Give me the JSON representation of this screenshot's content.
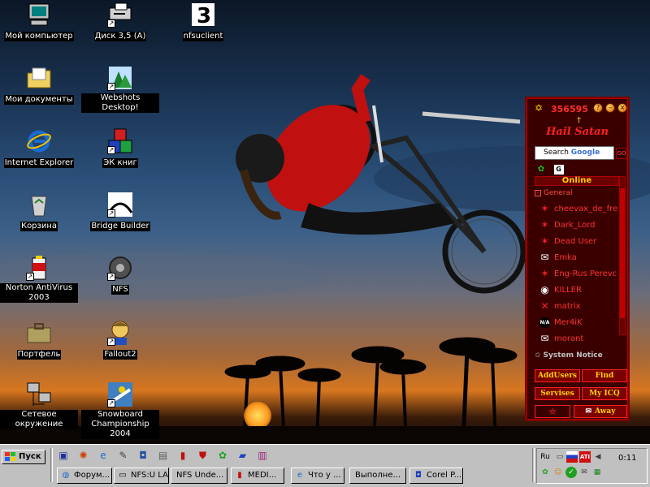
{
  "desktop": {
    "icons": [
      {
        "label": "Мой компьютер",
        "icon": "my-computer-icon"
      },
      {
        "label": "Диск 3,5 (А)",
        "icon": "floppy-drive-icon"
      },
      {
        "label": "nfsuclient",
        "icon": "nfsuclient-icon"
      },
      {
        "label": "Мои документы",
        "icon": "my-documents-icon"
      },
      {
        "label": "Webshots Desktop!",
        "icon": "webshots-icon"
      },
      {
        "label": "Internet Explorer",
        "icon": "internet-explorer-icon"
      },
      {
        "label": "ЭК книг",
        "icon": "ek-books-icon"
      },
      {
        "label": "Корзина",
        "icon": "recycle-bin-icon"
      },
      {
        "label": "Bridge Builder",
        "icon": "bridge-builder-icon"
      },
      {
        "label": "Norton AntiVirus 2003",
        "icon": "norton-antivirus-icon"
      },
      {
        "label": "NFS",
        "icon": "nfs-icon"
      },
      {
        "label": "Портфель",
        "icon": "briefcase-icon"
      },
      {
        "label": "Fallout2",
        "icon": "fallout2-icon"
      },
      {
        "label": "Сетевое окружение",
        "icon": "network-neighborhood-icon"
      },
      {
        "label": "Snowboard Championship 2004",
        "icon": "snowboard-championship-icon"
      }
    ]
  },
  "icq": {
    "uin": "356595",
    "title": "Hail Satan",
    "search_prefix": "Search",
    "search_brand": "Google",
    "go_label": "GO",
    "online_header": "Online",
    "group_name": "General",
    "contacts": [
      {
        "name": "cheevax_de_fre",
        "icon": "star-icon"
      },
      {
        "name": "Dark_Lord",
        "icon": "star-icon"
      },
      {
        "name": "Dead User",
        "icon": "star-icon"
      },
      {
        "name": "Emka",
        "icon": "envelope-icon"
      },
      {
        "name": "Eng-Rus Perevc",
        "icon": "star-icon"
      },
      {
        "name": "KILLER",
        "icon": "eye-icon"
      },
      {
        "name": "matrix",
        "icon": "cross-icon"
      },
      {
        "name": "Mer4iK",
        "icon": "na-icon"
      },
      {
        "name": "morant",
        "icon": "envelope-icon"
      }
    ],
    "system_notice": "System Notice",
    "buttons": {
      "add_users": "AddUsers",
      "find": "Find",
      "services": "Servises",
      "my_icq": "My ICQ",
      "away": "Away"
    },
    "colors": {
      "panel": "#3a0000",
      "text": "#ff3030",
      "accent": "#ffd000"
    }
  },
  "taskbar": {
    "start_label": "Пуск",
    "quick_launch": [
      "save-icon",
      "fire-icon",
      "ie-icon",
      "pen-icon",
      "camera-icon",
      "app-icon",
      "norton-icon",
      "shield-icon",
      "icq-flower-icon",
      "book-icon",
      "books-icon"
    ],
    "tasks": [
      {
        "label": "Форум...",
        "icon": "globe-icon"
      },
      {
        "label": "NFS:U LA...",
        "icon": "window-icon"
      },
      {
        "label": "NFS Unde...",
        "icon": "window-icon"
      },
      {
        "label": "MEDI...",
        "icon": "medi-icon"
      },
      {
        "label": "Что у ...",
        "icon": "ie-icon"
      },
      {
        "label": "Выполне...",
        "icon": "window-icon"
      },
      {
        "label": "Corel P...",
        "icon": "corel-icon"
      }
    ],
    "tray": {
      "lang": "Ru",
      "time": "0:11"
    }
  }
}
